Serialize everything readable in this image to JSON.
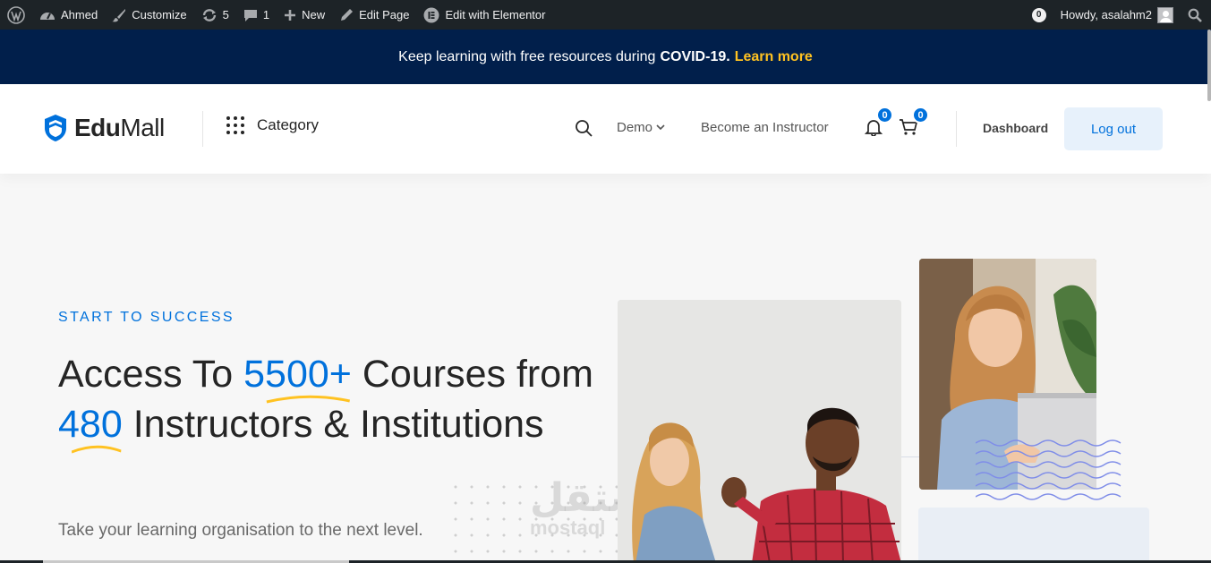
{
  "adminbar": {
    "site_name": "Ahmed",
    "customize": "Customize",
    "updates_count": "5",
    "comments_count": "1",
    "new_label": "New",
    "edit_page": "Edit Page",
    "edit_elementor": "Edit with Elementor",
    "notification_count": "0",
    "howdy": "Howdy, asalahm2"
  },
  "notice": {
    "text": "Keep learning with free resources during",
    "highlight": "COVID-19.",
    "link": "Learn more"
  },
  "header": {
    "logo_part1": "Edu",
    "logo_part2": "Mall",
    "category": "Category",
    "demo": "Demo",
    "instructor": "Become an Instructor",
    "bell_badge": "0",
    "cart_badge": "0",
    "dashboard": "Dashboard",
    "logout": "Log out"
  },
  "hero": {
    "eyebrow": "START TO SUCCESS",
    "title_p1": "Access To",
    "title_hl1": "5500+",
    "title_p2": "Courses from",
    "title_hl2": "480",
    "title_p3": "Instructors & Institutions",
    "subtitle": "Take your learning organisation to the next level."
  },
  "watermark": {
    "arabic": "مستقل",
    "latin": "mostaql"
  },
  "colors": {
    "primary": "#0071dc",
    "accent": "#ffc221",
    "banner_bg": "#011f4b",
    "adminbar_bg": "#1d2327"
  }
}
